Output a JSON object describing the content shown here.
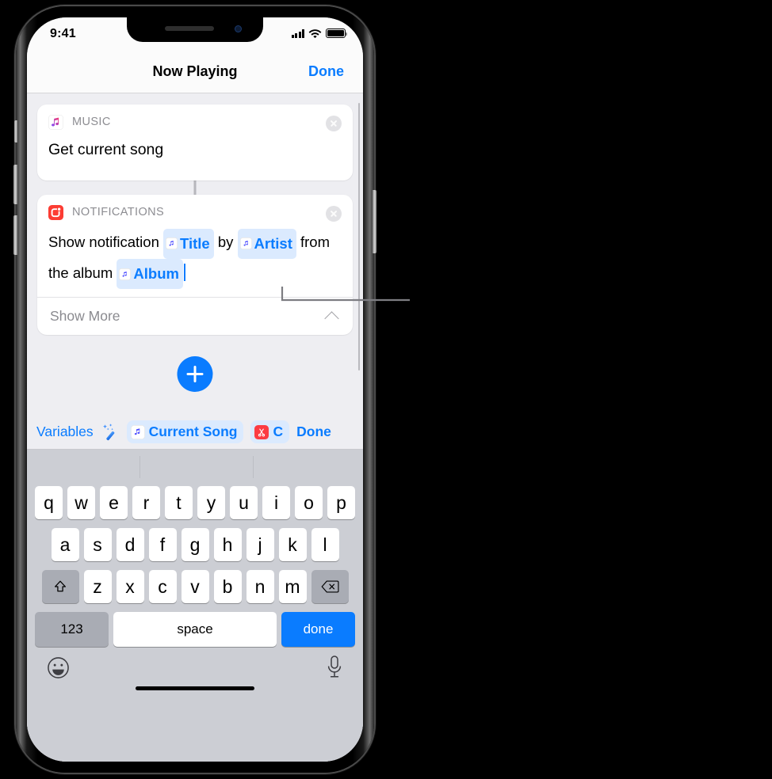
{
  "status_bar": {
    "time": "9:41",
    "signal_icon": "cellular-bars-icon",
    "wifi_icon": "wifi-icon",
    "battery_icon": "battery-full-icon"
  },
  "nav_bar": {
    "title": "Now Playing",
    "done_label": "Done"
  },
  "actions": [
    {
      "app_label": "MUSIC",
      "app_icon": "music-app-icon",
      "title": "Get current song",
      "remove_icon": "remove-circle-icon"
    },
    {
      "app_label": "NOTIFICATIONS",
      "app_icon": "notifications-app-icon",
      "remove_icon": "remove-circle-icon",
      "text_parts": {
        "p1": "Show notification",
        "tok1": "Title",
        "p2": "by",
        "tok2": "Artist",
        "p3": "from the album",
        "tok3": "Album"
      },
      "show_more_label": "Show More",
      "show_more_icon": "chevron-up-icon"
    }
  ],
  "add_button": {
    "icon": "plus-icon",
    "color": "#0a7cff"
  },
  "accessory_bar": {
    "variables_label": "Variables",
    "magic_wand_icon": "magic-wand-icon",
    "chips": [
      {
        "label": "Current Song",
        "icon": "music-note-icon"
      },
      {
        "label": "C",
        "icon": "scissors-clipboard-icon"
      }
    ],
    "done_label": "Done"
  },
  "keyboard": {
    "row1": [
      "q",
      "w",
      "e",
      "r",
      "t",
      "y",
      "u",
      "i",
      "o",
      "p"
    ],
    "row2": [
      "a",
      "s",
      "d",
      "f",
      "g",
      "h",
      "j",
      "k",
      "l"
    ],
    "row3_letters": [
      "z",
      "x",
      "c",
      "v",
      "b",
      "n",
      "m"
    ],
    "shift_icon": "shift-arrow-icon",
    "delete_icon": "backspace-icon",
    "numbers_label": "123",
    "space_label": "space",
    "done_label": "done",
    "emoji_icon": "emoji-smiley-icon",
    "mic_icon": "microphone-icon"
  },
  "colors": {
    "accent_blue": "#0a7cff",
    "token_bg": "#dbeafe",
    "keyboard_bg": "#ccced4",
    "content_bg": "#eeeef2",
    "notifications_red": "#fc3c33"
  }
}
